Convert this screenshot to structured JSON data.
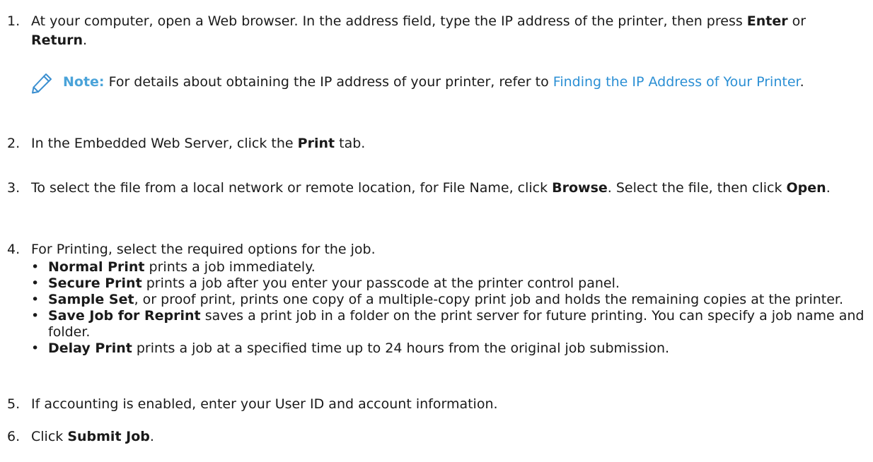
{
  "steps": {
    "s1": {
      "num": "1.",
      "pre": "At your computer, open a Web browser. In the address field, type the IP address of the printer, then press ",
      "bold1": "Enter",
      "mid": " or ",
      "bold2": "Return",
      "post": "."
    },
    "note": {
      "icon": "pencil-icon",
      "label": "Note:",
      "text": " For details about obtaining the IP address of your printer, refer to ",
      "link": "Finding the IP Address of Your Printer",
      "post": "."
    },
    "s2": {
      "num": "2.",
      "pre": "In the Embedded Web Server, click the ",
      "bold": "Print",
      "post": " tab."
    },
    "s3": {
      "num": "3.",
      "pre": "To select the file from a local network or remote location, for File Name, click ",
      "bold1": "Browse",
      "mid": ". Select the file, then click ",
      "bold2": "Open",
      "post": "."
    },
    "s4": {
      "num": "4.",
      "text": "For Printing, select the required options for the job."
    },
    "bullets": [
      {
        "bold": "Normal Print",
        "text": " prints a job immediately."
      },
      {
        "bold": "Secure Print",
        "text": " prints a job after you enter your passcode at the printer control panel."
      },
      {
        "bold": "Sample Set",
        "text": ", or proof print, prints one copy of a multiple-copy print job and holds the remaining copies at the printer."
      },
      {
        "bold": "Save Job for Reprint",
        "text": " saves a print job in a folder on the print server for future printing. You can specify a job name and folder."
      },
      {
        "bold": "Delay Print",
        "text": " prints a job at a specified time up to 24 hours from the original job submission."
      }
    ],
    "s5": {
      "num": "5.",
      "text": "If accounting is enabled, enter your User ID and account information."
    },
    "s6": {
      "num": "6.",
      "pre": "Click ",
      "bold": "Submit Job",
      "post": "."
    }
  },
  "colors": {
    "note_label": "#4aa3d9",
    "link": "#2b8fd4",
    "icon": "#3b8fd0"
  }
}
